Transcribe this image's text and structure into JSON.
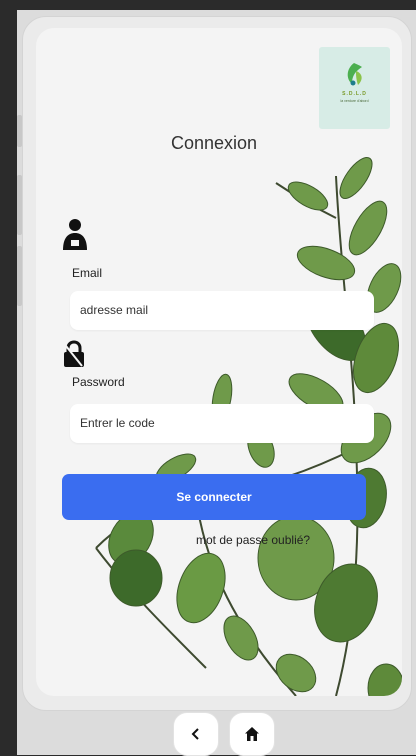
{
  "logo": {
    "name": "S.D.L.D",
    "tagline": "la verdure d'abord"
  },
  "login": {
    "title": "Connexion",
    "email_label": "Email",
    "email_placeholder": "adresse mail",
    "password_label": "Password",
    "password_placeholder": "Entrer le code",
    "submit_label": "Se connecter",
    "forgot_label": "mot de passe oublié?"
  },
  "nav": {
    "back_icon": "chevron-left-icon",
    "home_icon": "home-icon"
  },
  "colors": {
    "primary": "#3a6df0",
    "leaf": "#5a8a3c",
    "logo_bg": "#d7ece6"
  }
}
